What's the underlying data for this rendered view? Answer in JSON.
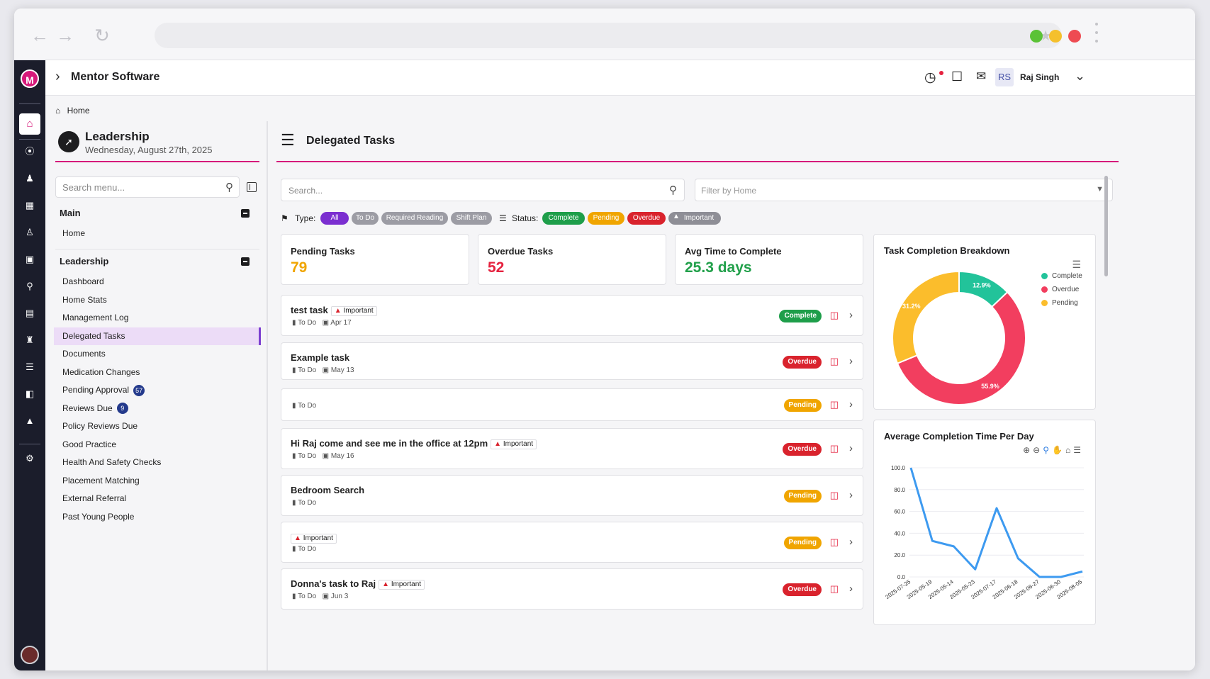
{
  "app": {
    "title": "Mentor Software",
    "user_initials": "RS",
    "user_name": "Raj Singh"
  },
  "breadcrumb": {
    "home": "Home"
  },
  "leadership": {
    "title": "Leadership",
    "date": "Wednesday, August 27th, 2025"
  },
  "menu": {
    "search_placeholder": "Search menu...",
    "main_title": "Main",
    "main_items": [
      {
        "label": "Home"
      }
    ],
    "leadership_title": "Leadership",
    "leadership_items": [
      {
        "label": "Dashboard"
      },
      {
        "label": "Home Stats"
      },
      {
        "label": "Management Log"
      },
      {
        "label": "Delegated Tasks"
      },
      {
        "label": "Documents"
      },
      {
        "label": "Medication Changes"
      },
      {
        "label": "Pending Approval",
        "count": "57"
      },
      {
        "label": "Reviews Due",
        "count": "9"
      },
      {
        "label": "Policy Reviews Due"
      },
      {
        "label": "Good Practice"
      },
      {
        "label": "Health And Safety Checks"
      },
      {
        "label": "Placement Matching"
      },
      {
        "label": "External Referral"
      },
      {
        "label": "Past Young People"
      }
    ]
  },
  "tasks_panel": {
    "title": "Delegated Tasks",
    "search_placeholder": "Search...",
    "filter_placeholder": "Filter by Home",
    "type_label": "Type:",
    "status_label": "Status:",
    "type_chips": [
      "All",
      "To Do",
      "Required Reading",
      "Shift Plan"
    ],
    "status_chips": [
      "Complete",
      "Pending",
      "Overdue",
      "Important"
    ]
  },
  "stats": [
    {
      "label": "Pending Tasks",
      "value": "79",
      "color": "#f0a500"
    },
    {
      "label": "Overdue Tasks",
      "value": "52",
      "color": "#e5223f"
    },
    {
      "label": "Avg Time to Complete",
      "value": "25.3 days",
      "color": "#21a04a"
    }
  ],
  "tasks": [
    {
      "name": "test task",
      "important": true,
      "type": "To Do",
      "date": "Apr 17",
      "status": "Complete"
    },
    {
      "name": "Example task",
      "important": false,
      "type": "To Do",
      "date": "May 13",
      "status": "Overdue"
    },
    {
      "name": "",
      "important": false,
      "type": "To Do",
      "date": "",
      "status": "Pending"
    },
    {
      "name": "Hi Raj come and see me in the office at 12pm",
      "important": true,
      "type": "To Do",
      "date": "May 16",
      "status": "Overdue"
    },
    {
      "name": "Bedroom Search",
      "important": false,
      "type": "To Do",
      "date": "",
      "status": "Pending"
    },
    {
      "name": "",
      "important": true,
      "type": "To Do",
      "date": "",
      "status": "Pending"
    },
    {
      "name": "Donna's task to Raj",
      "important": true,
      "type": "To Do",
      "date": "Jun 3",
      "status": "Overdue"
    }
  ],
  "important_label": "Important",
  "status_colors": {
    "Complete": "#1e9e4a",
    "Pending": "#f0a500",
    "Overdue": "#d9232d",
    "Important": "#8e8e96"
  },
  "chart_data": [
    {
      "type": "pie",
      "title": "Task Completion Breakdown",
      "categories": [
        "Complete",
        "Overdue",
        "Pending"
      ],
      "values": [
        12.9,
        55.9,
        31.2
      ],
      "value_labels": [
        "12.9%",
        "55.9%",
        "31.2%"
      ],
      "colors": [
        "#22c39a",
        "#f23e5f",
        "#fbbd2c"
      ],
      "donut": true,
      "legend": "right"
    },
    {
      "type": "line",
      "title": "Average Completion Time Per Day",
      "x": [
        "2025-07-25",
        "2025-05-19",
        "2025-05-14",
        "2025-05-23",
        "2025-07-17",
        "2025-06-18",
        "2025-06-27",
        "2025-06-30",
        "2025-08-05"
      ],
      "y": [
        100,
        33,
        28,
        7,
        63,
        17,
        0,
        0,
        5
      ],
      "ylim": [
        0,
        100
      ],
      "yticks": [
        "100.0",
        "80.0",
        "60.0",
        "40.0",
        "20.0",
        "0.0"
      ],
      "color": "#3d9af0",
      "grid": true
    }
  ]
}
